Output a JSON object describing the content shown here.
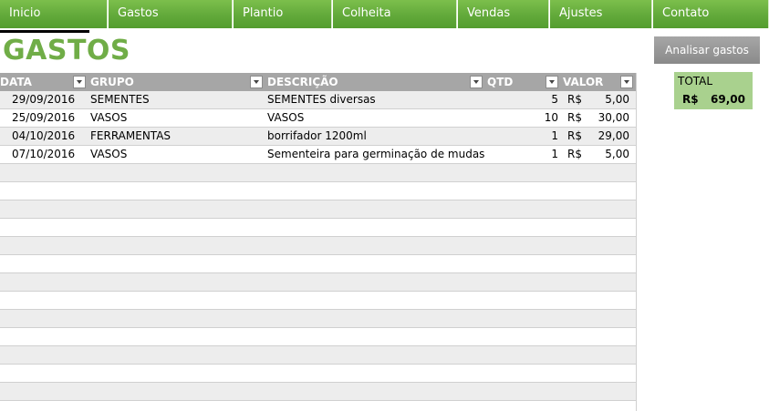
{
  "nav": {
    "items": [
      {
        "label": "Inicio"
      },
      {
        "label": "Gastos"
      },
      {
        "label": "Plantio"
      },
      {
        "label": "Colheita"
      },
      {
        "label": "Vendas"
      },
      {
        "label": "Ajustes"
      },
      {
        "label": "Contato"
      }
    ]
  },
  "page": {
    "title": "GASTOS"
  },
  "actions": {
    "analyse_label": "Analisar gastos"
  },
  "total": {
    "label": "TOTAL",
    "currency": "R$",
    "value": "69,00"
  },
  "table": {
    "headers": {
      "date": "DATA",
      "group": "GRUPO",
      "description": "DESCRIÇÃO",
      "qty": "QTD",
      "value": "VALOR"
    },
    "rows": [
      {
        "date": "29/09/2016",
        "group": "SEMENTES",
        "description": "SEMENTES diversas",
        "qty": "5",
        "currency": "R$",
        "value": "5,00"
      },
      {
        "date": "25/09/2016",
        "group": "VASOS",
        "description": "VASOS",
        "qty": "10",
        "currency": "R$",
        "value": "30,00"
      },
      {
        "date": "04/10/2016",
        "group": "FERRAMENTAS",
        "description": "borrifador 1200ml",
        "qty": "1",
        "currency": "R$",
        "value": "29,00"
      },
      {
        "date": "07/10/2016",
        "group": "VASOS",
        "description": "Sementeira para germinação de mudas",
        "qty": "1",
        "currency": "R$",
        "value": "5,00"
      }
    ]
  },
  "colors": {
    "nav_green": "#62a93a",
    "title_green": "#70ad47",
    "header_gray": "#a6a6a6",
    "total_green": "#a9d18e"
  }
}
